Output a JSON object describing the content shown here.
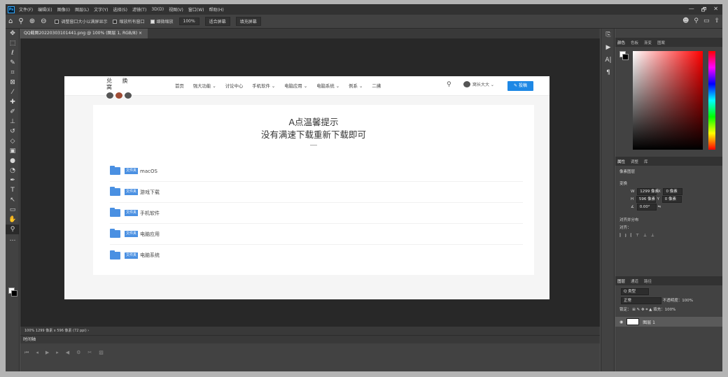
{
  "menubar": {
    "logo": "Ps",
    "items": [
      "文件(F)",
      "编辑(E)",
      "图像(I)",
      "图层(L)",
      "文字(Y)",
      "选择(S)",
      "滤镜(T)",
      "3D(D)",
      "视图(V)",
      "窗口(W)",
      "帮助(H)"
    ],
    "controls": [
      "—",
      "🗗",
      "✕"
    ]
  },
  "options": {
    "chk_resize": "调整窗口大小以满屏显示",
    "chk_all_windows": "缩放所有窗口",
    "chk_scrubby": "细微缩放",
    "zoom_btn": "100%",
    "fit_btn": "适合屏幕",
    "fill_btn": "填充屏幕"
  },
  "document": {
    "tab_label": "QQ截图20220303101441.png @ 100% (图层 1, RGB/8)",
    "status": "100%    1299 像素 x 596 像素 (72 ppi)    ›",
    "timeline_title": "时间轴"
  },
  "site": {
    "logo_text": "兑 换 窝",
    "nav": [
      "首页",
      "强大功能 ⌄",
      "讨论中心",
      "手机软件 ⌄",
      "电脑应用 ⌄",
      "电脑系统 ⌄",
      "例系 ⌄",
      "二拂"
    ],
    "user": "窝长大大 ⌄",
    "post_button": "投稿",
    "card_title": "A点温馨提示",
    "card_subtitle": "没有满速下载重新下载即可",
    "tag": "文件夹",
    "items": [
      "macOS",
      "游戏下载",
      "手机软件",
      "电脑应用",
      "电脑系统"
    ]
  },
  "panels": {
    "color_tabs": [
      "颜色",
      "色板",
      "渐变",
      "图案"
    ],
    "props_tabs": [
      "属性",
      "调整",
      "库"
    ],
    "pixel_layer": "像素图层",
    "transform": "变换",
    "w_label": "W",
    "w_value": "1299 像素",
    "x_label": "X",
    "x_value": "0 像素",
    "h_label": "H",
    "h_value": "596 像素",
    "y_label": "Y",
    "y_value": "0 像素",
    "angle_value": "0.00°",
    "align": "对齐并分布",
    "align_sub": "对齐：",
    "layers_tabs": [
      "图层",
      "通道",
      "路径"
    ],
    "kind": "Q 类型",
    "blend": "正常",
    "opacity": "不透明度：100%",
    "lock": "锁定：",
    "fill": "填充：100%",
    "layer_name": "图层 1"
  },
  "colors": {
    "accent": "#1e88e5",
    "folder": "#4a90e2"
  }
}
